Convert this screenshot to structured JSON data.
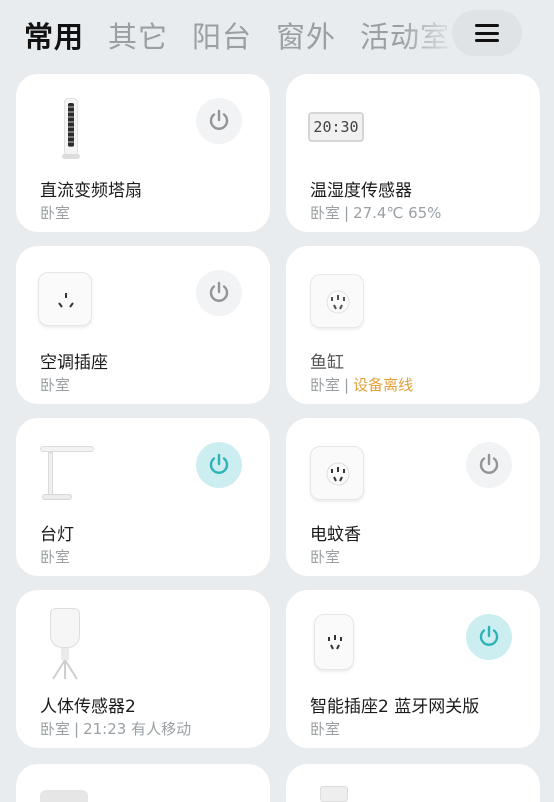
{
  "tabs": [
    "常用",
    "其它",
    "阳台",
    "窗外",
    "活动室"
  ],
  "menu_icon": "hamburger-menu-icon",
  "devices": [
    {
      "name": "直流变频塔扇",
      "room": "卧室",
      "status": "",
      "icon": "tower-fan-icon",
      "power": "off",
      "has_power": true
    },
    {
      "name": "温湿度传感器",
      "room": "卧室",
      "status": "27.4℃ 65%",
      "icon": "clock-sensor-icon",
      "display": "20:30",
      "has_power": false
    },
    {
      "name": "空调插座",
      "room": "卧室",
      "status": "",
      "icon": "ac-plug-icon",
      "power": "off",
      "has_power": true
    },
    {
      "name": "鱼缸",
      "room": "卧室",
      "status": "设备离线",
      "status_color": "#e2a23b",
      "icon": "smart-plug-icon",
      "has_power": false
    },
    {
      "name": "台灯",
      "room": "卧室",
      "status": "",
      "icon": "desk-lamp-icon",
      "power": "on",
      "has_power": true
    },
    {
      "name": "电蚊香",
      "room": "卧室",
      "status": "",
      "icon": "smart-plug-icon",
      "power": "off",
      "has_power": true
    },
    {
      "name": "人体传感器2",
      "room": "卧室",
      "status": "21:23 有人移动",
      "icon": "motion-sensor-icon",
      "has_power": false
    },
    {
      "name": "智能插座2 蓝牙网关版",
      "room": "卧室",
      "status": "",
      "icon": "smart-plug-icon",
      "power": "on",
      "has_power": true
    }
  ],
  "colors": {
    "power_on": "#2bb3b8",
    "power_off": "#8f9599",
    "background": "#e9ecee"
  }
}
